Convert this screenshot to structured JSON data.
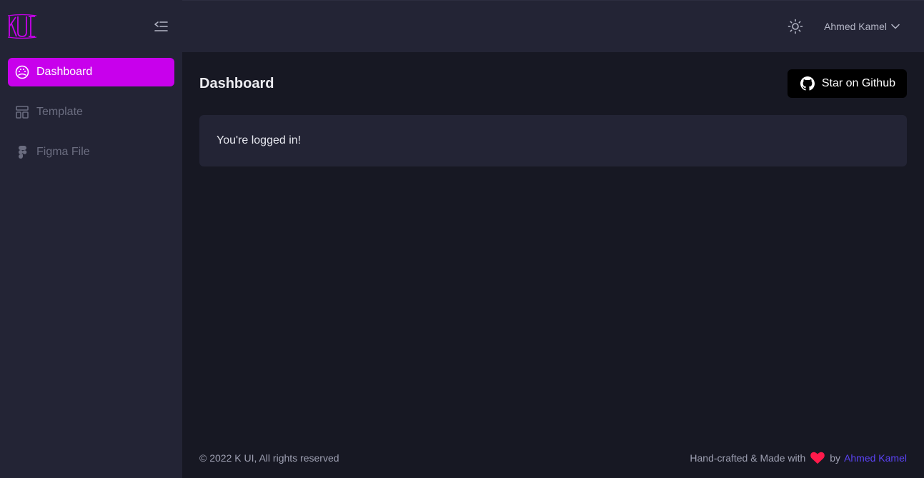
{
  "sidebar": {
    "logo_text": "KUI",
    "logo_color": "#c800ec",
    "items": [
      {
        "label": "Dashboard",
        "icon": "dashboard-gauge-icon",
        "active": true
      },
      {
        "label": "Template",
        "icon": "template-layout-icon",
        "active": false
      },
      {
        "label": "Figma File",
        "icon": "figma-icon",
        "active": false
      }
    ]
  },
  "topbar": {
    "theme_icon": "sun-icon",
    "user_name": "Ahmed Kamel"
  },
  "main": {
    "title": "Dashboard",
    "github_button": "Star on Github",
    "card_text": "You're logged in!"
  },
  "footer": {
    "copyright": "© 2022 K UI, All rights reserved",
    "made_with": "Hand-crafted & Made with",
    "by": "by",
    "author": "Ahmed Kamel"
  },
  "colors": {
    "accent": "#c800ec",
    "background": "#171823",
    "surface": "#232435",
    "link": "#5b43f5",
    "heart": "#ff1a4b"
  }
}
